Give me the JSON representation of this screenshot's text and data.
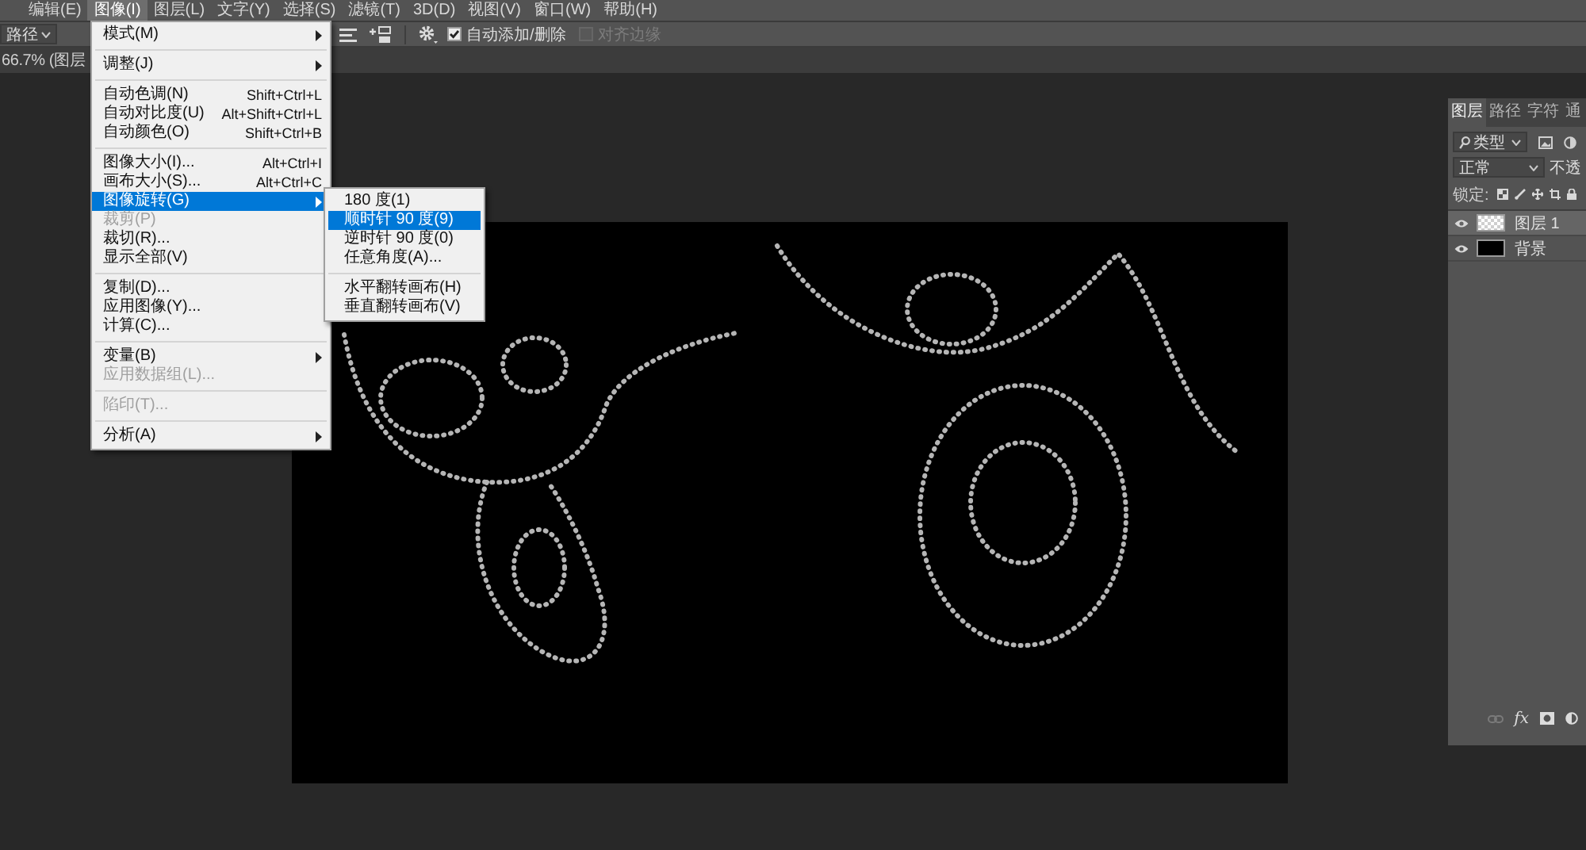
{
  "menu_bar": {
    "items": [
      {
        "label": "编辑(E)",
        "selected": false
      },
      {
        "label": "图像(I)",
        "selected": true
      },
      {
        "label": "图层(L)",
        "selected": false
      },
      {
        "label": "文字(Y)",
        "selected": false
      },
      {
        "label": "选择(S)",
        "selected": false
      },
      {
        "label": "滤镜(T)",
        "selected": false
      },
      {
        "label": "3D(D)",
        "selected": false
      },
      {
        "label": "视图(V)",
        "selected": false
      },
      {
        "label": "窗口(W)",
        "selected": false
      },
      {
        "label": "帮助(H)",
        "selected": false
      }
    ]
  },
  "options_bar": {
    "mode_dropdown": {
      "value": "路径"
    },
    "auto_add_delete": {
      "label": "自动添加/删除",
      "checked": true,
      "disabled": false
    },
    "align_edges": {
      "label": "对齐边缘",
      "checked": false,
      "disabled": true
    }
  },
  "document_tab": {
    "title": "66.7% (图层"
  },
  "image_menu": {
    "sections": [
      {
        "items": [
          {
            "label": "模式(M)",
            "selected": false,
            "disabled": false,
            "has_submenu": true
          }
        ]
      },
      {
        "items": [
          {
            "label": "调整(J)",
            "selected": false,
            "disabled": false,
            "has_submenu": true
          }
        ]
      },
      {
        "items": [
          {
            "label": "自动色调(N)",
            "shortcut": "Shift+Ctrl+L",
            "selected": false,
            "disabled": false,
            "has_submenu": false
          },
          {
            "label": "自动对比度(U)",
            "shortcut": "Alt+Shift+Ctrl+L",
            "selected": false,
            "disabled": false,
            "has_submenu": false
          },
          {
            "label": "自动颜色(O)",
            "shortcut": "Shift+Ctrl+B",
            "selected": false,
            "disabled": false,
            "has_submenu": false
          }
        ]
      },
      {
        "items": [
          {
            "label": "图像大小(I)...",
            "shortcut": "Alt+Ctrl+I",
            "selected": false,
            "disabled": false,
            "has_submenu": false
          },
          {
            "label": "画布大小(S)...",
            "shortcut": "Alt+Ctrl+C",
            "selected": false,
            "disabled": false,
            "has_submenu": false
          },
          {
            "label": "图像旋转(G)",
            "selected": true,
            "disabled": false,
            "has_submenu": true,
            "submenu": {
              "sections": [
                {
                  "items": [
                    {
                      "label": "180 度(1)",
                      "selected": false,
                      "disabled": false
                    },
                    {
                      "label": "顺时针 90 度(9)",
                      "selected": true,
                      "disabled": false
                    },
                    {
                      "label": "逆时针 90 度(0)",
                      "selected": false,
                      "disabled": false
                    },
                    {
                      "label": "任意角度(A)...",
                      "selected": false,
                      "disabled": false
                    }
                  ]
                },
                {
                  "items": [
                    {
                      "label": "水平翻转画布(H)",
                      "selected": false,
                      "disabled": false
                    },
                    {
                      "label": "垂直翻转画布(V)",
                      "selected": false,
                      "disabled": false
                    }
                  ]
                }
              ]
            }
          },
          {
            "label": "裁剪(P)",
            "selected": false,
            "disabled": true,
            "has_submenu": false
          },
          {
            "label": "裁切(R)...",
            "selected": false,
            "disabled": false,
            "has_submenu": false
          },
          {
            "label": "显示全部(V)",
            "selected": false,
            "disabled": false,
            "has_submenu": false
          }
        ]
      },
      {
        "items": [
          {
            "label": "复制(D)...",
            "selected": false,
            "disabled": false,
            "has_submenu": false
          },
          {
            "label": "应用图像(Y)...",
            "selected": false,
            "disabled": false,
            "has_submenu": false
          },
          {
            "label": "计算(C)...",
            "selected": false,
            "disabled": false,
            "has_submenu": false
          }
        ]
      },
      {
        "items": [
          {
            "label": "变量(B)",
            "selected": false,
            "disabled": false,
            "has_submenu": true
          },
          {
            "label": "应用数据组(L)...",
            "selected": false,
            "disabled": true,
            "has_submenu": false
          }
        ]
      },
      {
        "items": [
          {
            "label": "陷印(T)...",
            "selected": false,
            "disabled": true,
            "has_submenu": false
          }
        ]
      },
      {
        "items": [
          {
            "label": "分析(A)",
            "selected": false,
            "disabled": false,
            "has_submenu": true
          }
        ]
      }
    ]
  },
  "layers_panel": {
    "tabs": [
      {
        "label": "图层",
        "selected": true
      },
      {
        "label": "路径",
        "selected": false
      },
      {
        "label": "字符",
        "selected": false
      },
      {
        "label": "通",
        "selected": false
      }
    ],
    "filter": {
      "value": "类型"
    },
    "blend_mode": {
      "value": "正常"
    },
    "opacity_label": "不透",
    "lock_label": "锁定:",
    "layers": [
      {
        "name": "图层 1",
        "selected": true,
        "visible": true,
        "kind": "transparent"
      },
      {
        "name": "背景",
        "selected": false,
        "visible": true,
        "kind": "solid"
      }
    ],
    "footer": {
      "effects_label": "fx"
    }
  }
}
